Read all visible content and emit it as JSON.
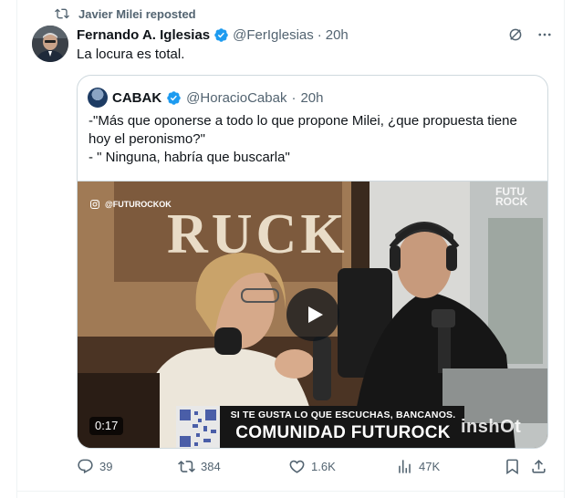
{
  "repost": {
    "label": "Javier Milei reposted",
    "icon": "repost-icon"
  },
  "tweet": {
    "author_name": "Fernando A. Iglesias",
    "handle": "@FerIglesias",
    "separator": "·",
    "time": "20h",
    "text": "La locura es total.",
    "verified_color": "#1d9bf0"
  },
  "quote": {
    "author_name": "CABAK",
    "handle": "@HoracioCabak",
    "separator": "·",
    "time": "20h",
    "lines": [
      "-\"Más que oponerse a todo lo que propone Milei, ¿que propuesta tiene",
      "hoy el peronismo?\"",
      "- \" Ninguna, habría que buscarla\""
    ]
  },
  "video": {
    "instagram_handle": "@FUTUROCKOK",
    "wall_sign": "RUCK",
    "logo_text_top": "FUTU",
    "logo_text_bottom": "ROCK",
    "banner_small": "SI TE GUSTA LO QUE ESCUCHAS, BANCANOS.",
    "banner_big": "COMUNIDAD FUTUROCK",
    "watermark": "inshOt",
    "duration": "0:17"
  },
  "actions": {
    "replies": "39",
    "reposts": "384",
    "likes": "1.6K",
    "views": "47K"
  },
  "colors": {
    "text_primary": "#0f1419",
    "text_secondary": "#536471",
    "border": "#cfd9de",
    "accent": "#1d9bf0"
  }
}
